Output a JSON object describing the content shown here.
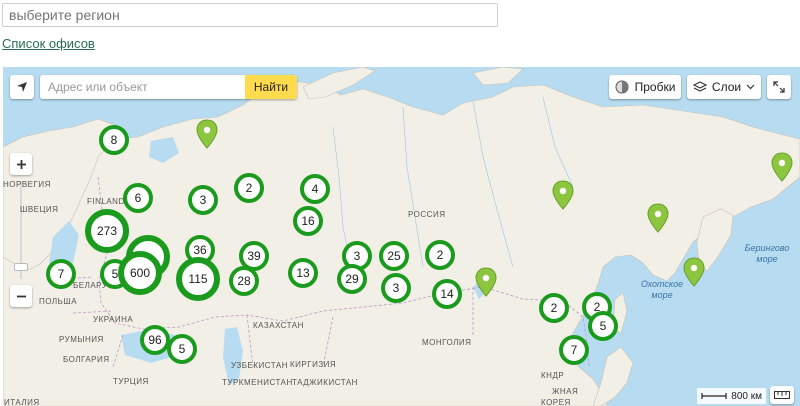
{
  "region_select": {
    "placeholder": "выберите регион"
  },
  "offices_link": {
    "label": "Список офисов"
  },
  "map": {
    "search": {
      "placeholder": "Адрес или объект",
      "button": "Найти"
    },
    "traffic_button": "Пробки",
    "layers_button": "Слои",
    "scale_label": "800 км",
    "country_labels": [
      {
        "text": "НОРВЕГИЯ"
      },
      {
        "text": "ШВЕЦИЯ"
      },
      {
        "text": "FINLAND"
      },
      {
        "text": "РОССИЯ"
      },
      {
        "text": "БЕЛАРУ"
      },
      {
        "text": "ПОЛЬША"
      },
      {
        "text": "УКРАИНА"
      },
      {
        "text": "РУМЫНИЯ"
      },
      {
        "text": "БОЛГАРИЯ"
      },
      {
        "text": "ТУРЦИЯ"
      },
      {
        "text": "КАЗАХСТАН"
      },
      {
        "text": "УЗБЕКИСТАН"
      },
      {
        "text": "КИРГИЗИЯ"
      },
      {
        "text": "ТУРКМЕНИСТАН"
      },
      {
        "text": "ТАДЖИКИСТАН"
      },
      {
        "text": "МОНГОЛИЯ"
      },
      {
        "text": "КНДР"
      },
      {
        "text": "ЖНАЯ"
      },
      {
        "text": "КОРЕЯ"
      },
      {
        "text": "ИТАЛИЯ"
      }
    ],
    "sea_labels": [
      {
        "text": "Охотское море"
      },
      {
        "text": "Берингово море"
      }
    ],
    "clusters": [
      {
        "count": "8"
      },
      {
        "count": "6"
      },
      {
        "count": "273"
      },
      {
        "count": "7"
      },
      {
        "count": "5"
      },
      {
        "count": "600"
      },
      {
        "count": ""
      },
      {
        "count": "36"
      },
      {
        "count": "115"
      },
      {
        "count": "3"
      },
      {
        "count": "2"
      },
      {
        "count": "4"
      },
      {
        "count": "16"
      },
      {
        "count": "39"
      },
      {
        "count": "28"
      },
      {
        "count": "13"
      },
      {
        "count": "3"
      },
      {
        "count": "25"
      },
      {
        "count": "29"
      },
      {
        "count": "3"
      },
      {
        "count": "2"
      },
      {
        "count": "14"
      },
      {
        "count": "96"
      },
      {
        "count": "5"
      },
      {
        "count": "2"
      },
      {
        "count": "2"
      },
      {
        "count": "5"
      },
      {
        "count": "7"
      }
    ],
    "colors": {
      "cluster_ring": "#1a9b1d",
      "pin": "#8cc63f",
      "search_button": "#ffdb4d",
      "water": "#b7dcf1",
      "land": "#f2efe6"
    }
  }
}
